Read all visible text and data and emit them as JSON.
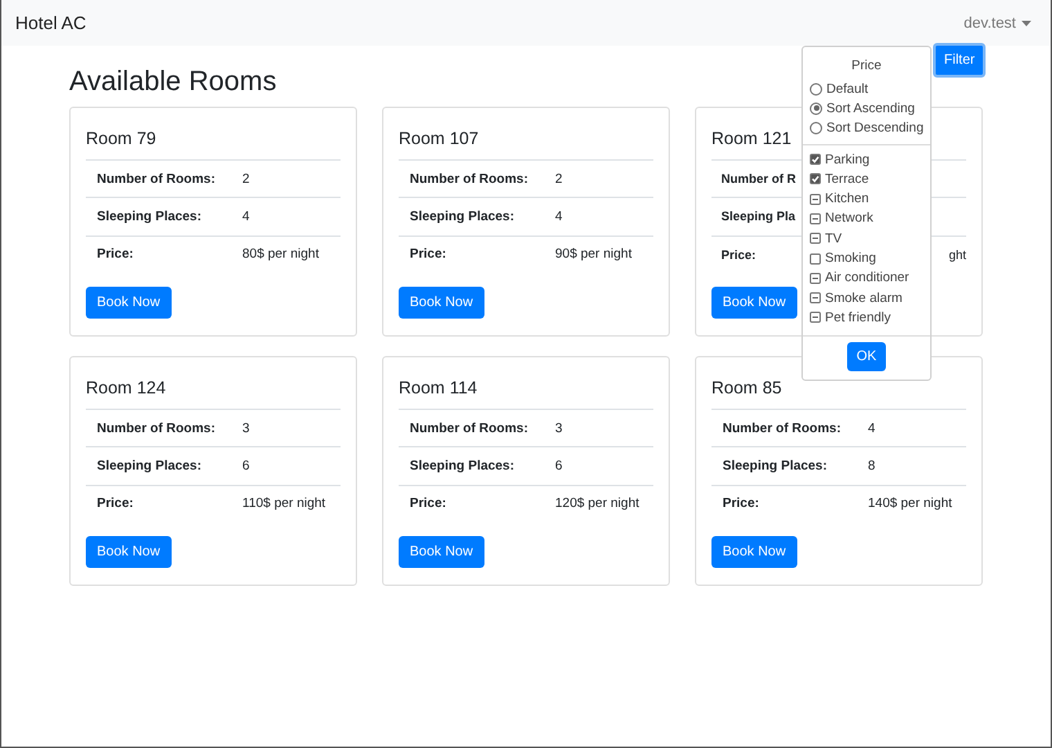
{
  "navbar": {
    "brand": "Hotel AC",
    "user_menu": "dev.test"
  },
  "heading": "Available Rooms",
  "filter_button": "Filter",
  "filter_menu": {
    "header": "Price",
    "sort_options": [
      {
        "label": "Default",
        "selected": false
      },
      {
        "label": "Sort Ascending",
        "selected": true
      },
      {
        "label": "Sort Descending",
        "selected": false
      }
    ],
    "amenities": [
      {
        "label": "Parking",
        "checked": true,
        "indeterminate": false
      },
      {
        "label": "Terrace",
        "checked": true,
        "indeterminate": false
      },
      {
        "label": "Kitchen",
        "checked": false,
        "indeterminate": true
      },
      {
        "label": "Network",
        "checked": false,
        "indeterminate": true
      },
      {
        "label": "TV",
        "checked": false,
        "indeterminate": true
      },
      {
        "label": "Smoking",
        "checked": false,
        "indeterminate": false
      },
      {
        "label": "Air conditioner",
        "checked": false,
        "indeterminate": true
      },
      {
        "label": "Smoke alarm",
        "checked": false,
        "indeterminate": true
      },
      {
        "label": "Pet friendly",
        "checked": false,
        "indeterminate": true
      }
    ],
    "ok_button": "OK"
  },
  "rooms": [
    {
      "kind": "full",
      "title": "Room 79",
      "rows": [
        {
          "label": "Number of Rooms:",
          "value": "2"
        },
        {
          "label": "Sleeping Places:",
          "value": "4"
        },
        {
          "label": "Price:",
          "value": "80$ per night"
        }
      ],
      "button": "Book Now"
    },
    {
      "kind": "full",
      "title": "Room 107",
      "rows": [
        {
          "label": "Number of Rooms:",
          "value": "2"
        },
        {
          "label": "Sleeping Places:",
          "value": "4"
        },
        {
          "label": "Price:",
          "value": "90$ per night"
        }
      ],
      "button": "Book Now"
    },
    {
      "kind": "covered",
      "title": "Room 121",
      "rows": [
        {
          "label": "Number of R"
        },
        {
          "label": "Sleeping Pla"
        },
        {
          "label": "Price:",
          "value": "ght"
        }
      ],
      "button": "Book Now"
    },
    {
      "kind": "full",
      "title": "Room 124",
      "rows": [
        {
          "label": "Number of Rooms:",
          "value": "3"
        },
        {
          "label": "Sleeping Places:",
          "value": "6"
        },
        {
          "label": "Price:",
          "value": "110$ per night"
        }
      ],
      "button": "Book Now"
    },
    {
      "kind": "full",
      "title": "Room 114",
      "rows": [
        {
          "label": "Number of Rooms:",
          "value": "3"
        },
        {
          "label": "Sleeping Places:",
          "value": "6"
        },
        {
          "label": "Price:",
          "value": "120$ per night"
        }
      ],
      "button": "Book Now"
    },
    {
      "kind": "full",
      "title": "Room 85",
      "rows": [
        {
          "label": "Number of Rooms:",
          "value": "4"
        },
        {
          "label": "Sleeping Places:",
          "value": "8"
        },
        {
          "label": "Price:",
          "value": "140$ per night"
        }
      ],
      "button": "Book Now"
    }
  ]
}
